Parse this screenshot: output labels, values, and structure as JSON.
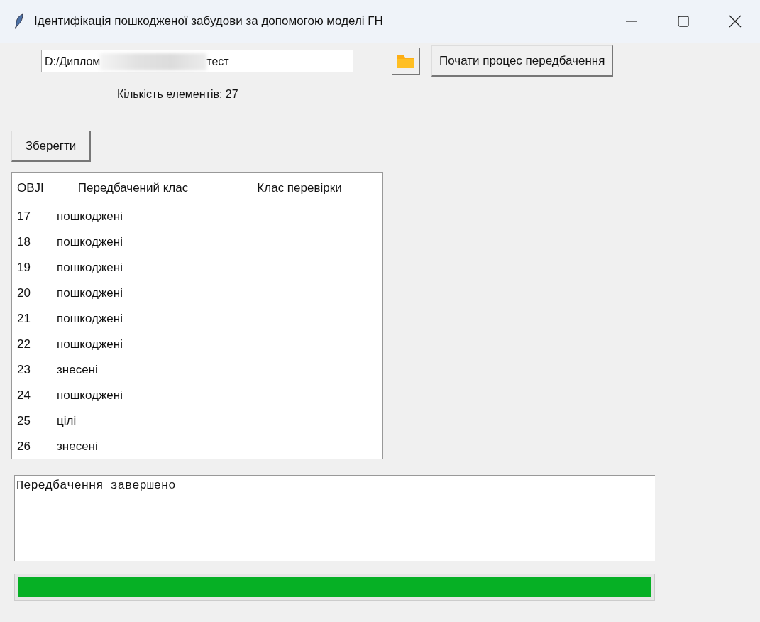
{
  "window": {
    "title": "Ідентифікація пошкодженої забудови за допомогою моделі ГН"
  },
  "path_field": {
    "value_start": "D:/Диплом",
    "redacted": true,
    "value_end": "тест"
  },
  "start_button": {
    "label": "Почати процес передбачення"
  },
  "count_label": "Кількість елементів: 27",
  "save_button": {
    "label": "Зберегти"
  },
  "table": {
    "columns": [
      "OBJI",
      "Передбачений клас",
      "Клас перевірки"
    ],
    "rows": [
      {
        "id": "17",
        "predicted": "пошкоджені"
      },
      {
        "id": "18",
        "predicted": "пошкоджені"
      },
      {
        "id": "19",
        "predicted": "пошкоджені"
      },
      {
        "id": "20",
        "predicted": "пошкоджені"
      },
      {
        "id": "21",
        "predicted": "пошкоджені"
      },
      {
        "id": "22",
        "predicted": "пошкоджені"
      },
      {
        "id": "23",
        "predicted": "знесені"
      },
      {
        "id": "24",
        "predicted": "пошкоджені"
      },
      {
        "id": "25",
        "predicted": "цілі"
      },
      {
        "id": "26",
        "predicted": "знесені"
      }
    ]
  },
  "log": "Передбачення завершено",
  "progress": {
    "level": 1
  }
}
